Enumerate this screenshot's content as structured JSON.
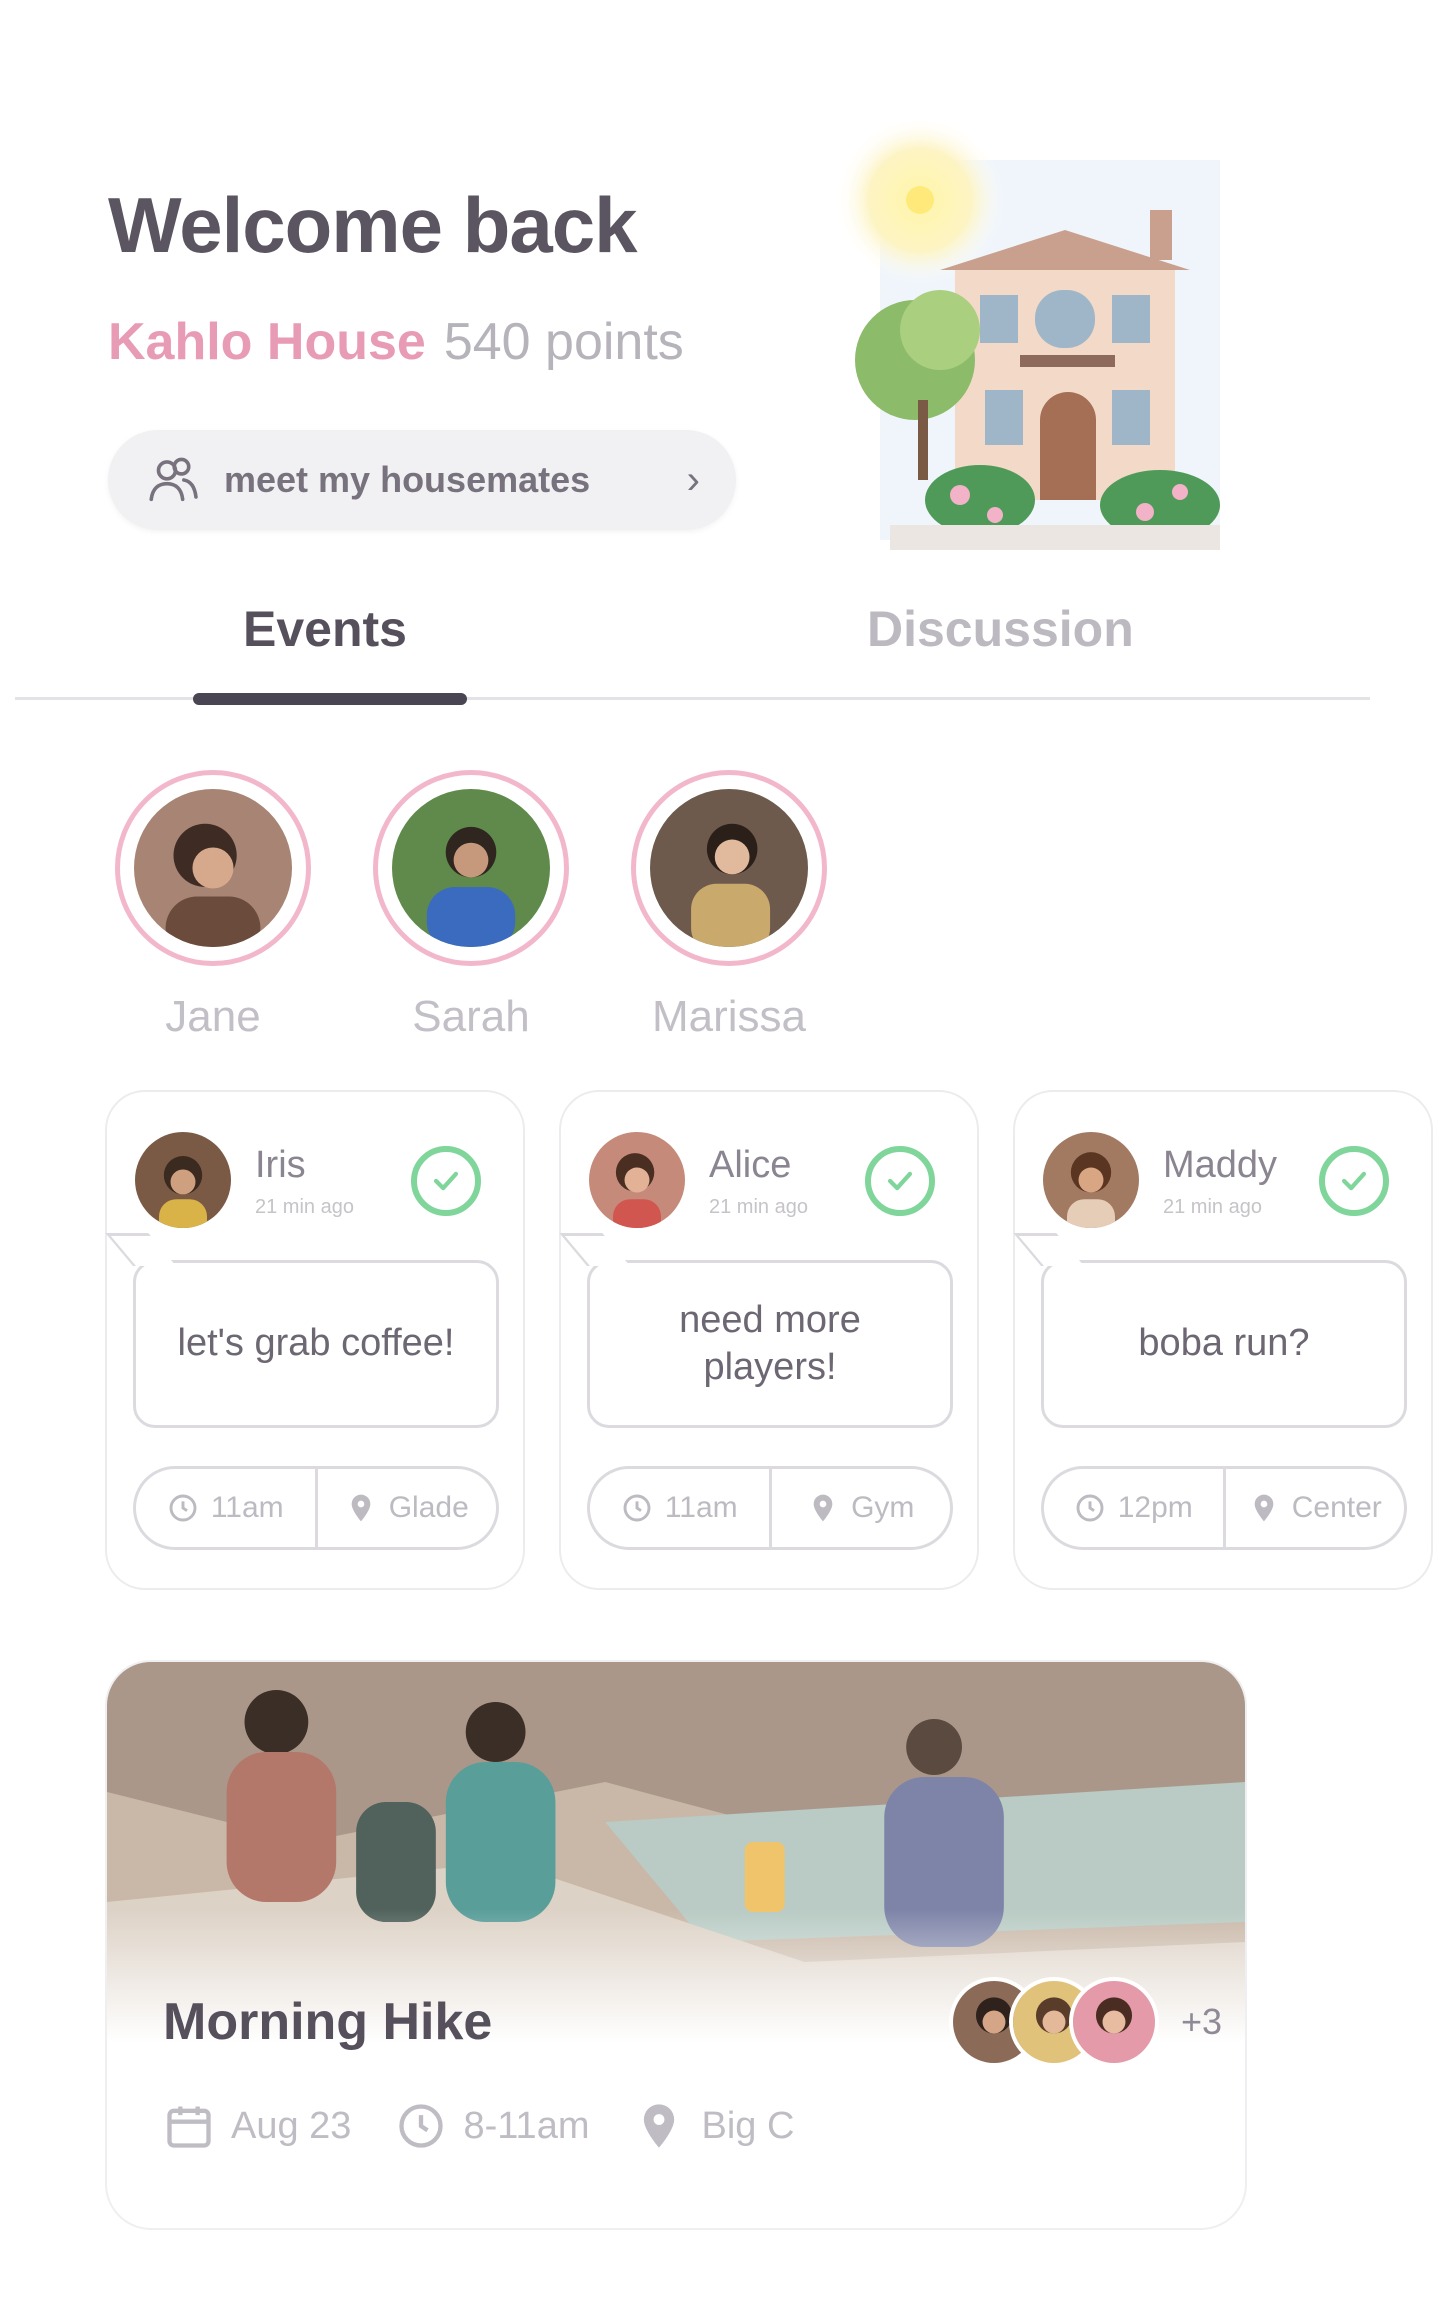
{
  "header": {
    "greeting": "Welcome back",
    "house_name": "Kahlo House",
    "points": "540 points",
    "meet_label": "meet my housemates"
  },
  "tabs": [
    {
      "label": "Events",
      "active": true
    },
    {
      "label": "Discussion",
      "active": false
    }
  ],
  "stories": [
    {
      "name": "Jane"
    },
    {
      "name": "Sarah"
    },
    {
      "name": "Marissa"
    }
  ],
  "posts": [
    {
      "user": "Iris",
      "time": "21 min ago",
      "message": "let's grab coffee!",
      "when": "11am",
      "where": "Glade"
    },
    {
      "user": "Alice",
      "time": "21 min ago",
      "message": "need more players!",
      "when": "11am",
      "where": "Gym"
    },
    {
      "user": "Maddy",
      "time": "21 min ago",
      "message": "boba run?",
      "when": "12pm",
      "where": "Center"
    }
  ],
  "event": {
    "title": "Morning Hike",
    "more_count": "+3",
    "date": "Aug 23",
    "time": "8-11am",
    "place": "Big C"
  },
  "colors": {
    "accent_pink": "#e89bb4",
    "check_green": "#7fd59a",
    "text_dark": "#4a4552"
  },
  "icons": [
    "people-icon",
    "chevron-right-icon",
    "check-icon",
    "clock-icon",
    "location-pin-icon",
    "calendar-icon"
  ]
}
